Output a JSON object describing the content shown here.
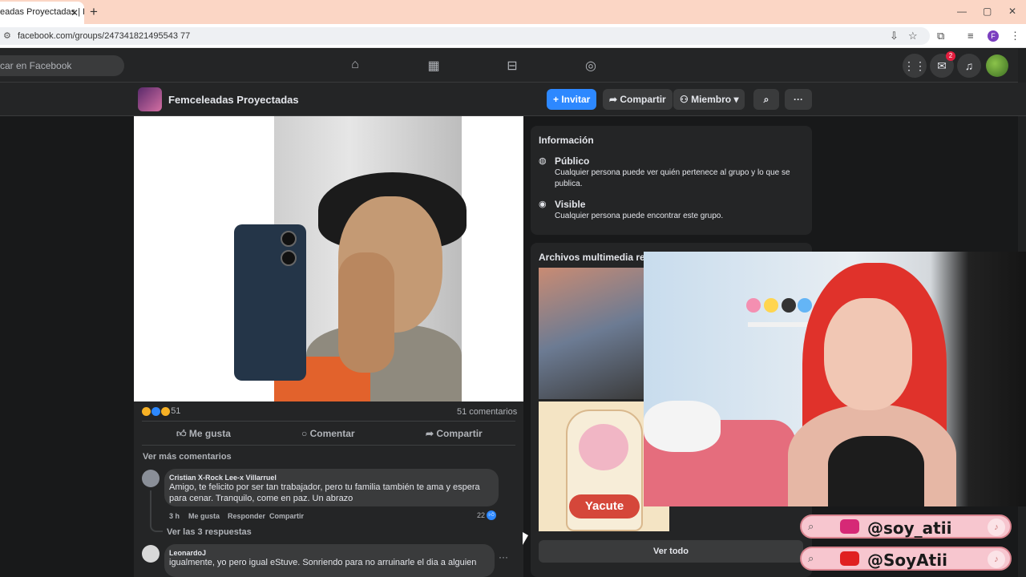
{
  "browser": {
    "tab_title": "eadas Proyectadas | F",
    "tab_close": "✕",
    "new_tab": "+",
    "url": "facebook.com/groups/247341821495543 77",
    "window_buttons": [
      "—",
      "▢",
      "✕"
    ],
    "profile_initial": "F"
  },
  "fbnav": {
    "search_placeholder": "car en Facebook",
    "nav_icons": [
      "home-icon",
      "pages-icon",
      "marketplace-icon",
      "gaming-icon"
    ],
    "messenger_badge": "2"
  },
  "group": {
    "name": "Femceleadas Proyectadas",
    "invite_label": "Invitar",
    "share_label": "Compartir",
    "member_label": "Miembro",
    "more_label": "···"
  },
  "post": {
    "reaction_count": "51",
    "comment_count": "51 comentarios",
    "like_label": "Me gusta",
    "comment_label": "Comentar",
    "share_label": "Compartir",
    "more_comments": "Ver más comentarios",
    "comments": [
      {
        "author": "Cristian X-Rock Lee-x Villarruel",
        "text": "Amigo, te felicito por ser tan trabajador, pero tu familia también te ama y espera para cenar. Tranquilo, come en paz. Un abrazo",
        "time": "3 h",
        "like": "Me gusta",
        "reply": "Responder",
        "share": "Compartir",
        "likes": "22",
        "replies": "Ver las 3 respuestas"
      },
      {
        "author": "LeonardoJ",
        "text": "igualmente, yo pero igual eStuve. Sonriendo para no arruinarle el dia a alguien"
      }
    ]
  },
  "info": {
    "title": "Información",
    "public_title": "Público",
    "public_desc": "Cualquier persona puede ver quién pertenece al grupo y lo que se publica.",
    "visible_title": "Visible",
    "visible_desc": "Cualquier persona puede encontrar este grupo."
  },
  "media": {
    "title": "Archivos multimedia rec",
    "bottle_label": "Yacute",
    "see_all": "Ver todo"
  },
  "overlay": {
    "instagram": "@soy_atii",
    "youtube": "@SoyAtii",
    "instagram_color": "#d62976",
    "youtube_color": "#e02020"
  }
}
